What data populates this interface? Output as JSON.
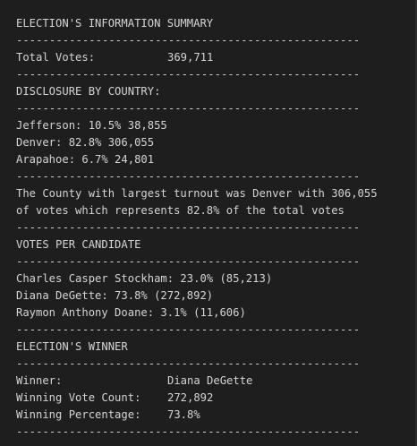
{
  "title": "ELECTION'S INFORMATION SUMMARY",
  "separator": "----------------------------------------------------",
  "total_votes": {
    "label": "Total Votes:",
    "value": "369,711"
  },
  "county_section": {
    "heading": "DISCLOSURE BY COUNTRY:",
    "rows": [
      "Jefferson: 10.5% 38,855",
      "Denver: 82.8% 306,055",
      "Arapahoe: 6.7% 24,801"
    ]
  },
  "largest_turnout": {
    "line1": "The County with largest turnout was Denver with 306,055",
    "line2": "of votes which represents 82.8% of the total votes"
  },
  "candidate_section": {
    "heading": "VOTES PER CANDIDATE",
    "rows": [
      "Charles Casper Stockham: 23.0% (85,213)",
      "Diana DeGette: 73.8% (272,892)",
      "Raymon Anthony Doane: 3.1% (11,606)"
    ]
  },
  "winner_section": {
    "heading": "ELECTION'S WINNER",
    "winner": {
      "label": "Winner:",
      "value": "Diana DeGette"
    },
    "count": {
      "label": "Winning Vote Count:",
      "value": "272,892"
    },
    "percentage": {
      "label": "Winning Percentage:",
      "value": "73.8%"
    }
  }
}
